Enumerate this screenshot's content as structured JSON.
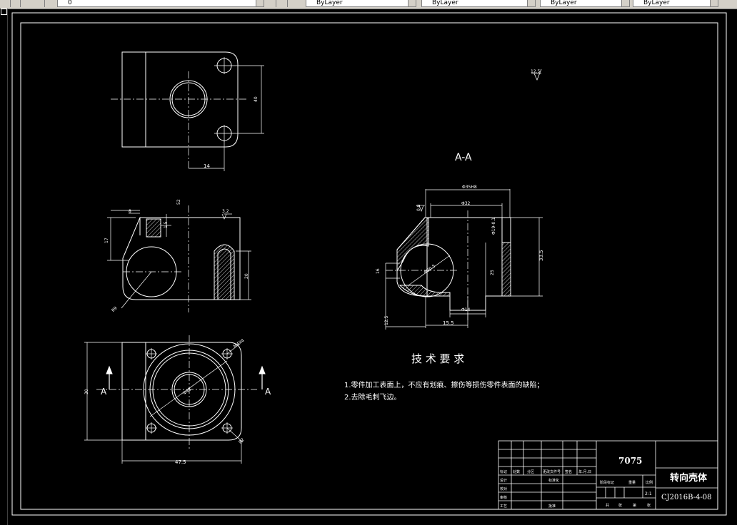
{
  "toolbar": {
    "layer_value": "0",
    "color_value": "ByLayer",
    "linetype_value": "ByLayer",
    "lineweight_value": "ByLayer",
    "plotstyle_value": "ByLayer"
  },
  "top_view": {
    "dim_height": "40",
    "dim_bottom": "14"
  },
  "front_view": {
    "dim_top_width": "8",
    "dim_top_depth": "52",
    "dim_roughness": "3.2",
    "dim_left_height": "17",
    "dim_hole_depth": "1.5",
    "dim_right_height": "20",
    "dim_radius": "R9"
  },
  "section_view": {
    "title": "A-A",
    "dim_outer_dia": "Φ35H8",
    "dim_inner_dia": "Φ32",
    "dim_roughness": "0.8",
    "dim_bore": "Φ19-0.1",
    "dim_total_height": "33.5",
    "dim_mid": "25",
    "dim_side": "16",
    "dim_bottom_small": "Φ14",
    "dim_bottom_width": "15.5",
    "dim_base": "12.5",
    "dim_circle": "Φ30.5"
  },
  "bottom_view": {
    "dim_height": "30",
    "dim_width": "47.5",
    "dim_thread": "M4X4",
    "dim_circle": "Φ43",
    "dim_r": "R2",
    "section_label_left": "A",
    "section_label_right": "A"
  },
  "surface_finish": "12.5",
  "tech_requirements": {
    "heading": "技 术 要 求",
    "item1": "1.零件加工表面上，不应有划痕、擦伤等损伤零件表面的缺陷；",
    "item2": "2.去除毛刺飞边。"
  },
  "title_block": {
    "material": "7075",
    "part_name": "转向壳体",
    "drawing_no": "CJ2016B-4-08",
    "scale": "2:1",
    "row_labels": [
      "标记",
      "处数",
      "分区",
      "更改文件号",
      "签名",
      "年.月.日"
    ],
    "label_design": "设计",
    "label_check": "校对",
    "label_review": "审核",
    "label_process": "工艺",
    "label_standard": "标准化",
    "label_approve": "批准",
    "stage_labels": [
      "阶段标记",
      "重量",
      "比例"
    ],
    "sheet_labels": [
      "共",
      "张",
      "第",
      "张"
    ]
  }
}
